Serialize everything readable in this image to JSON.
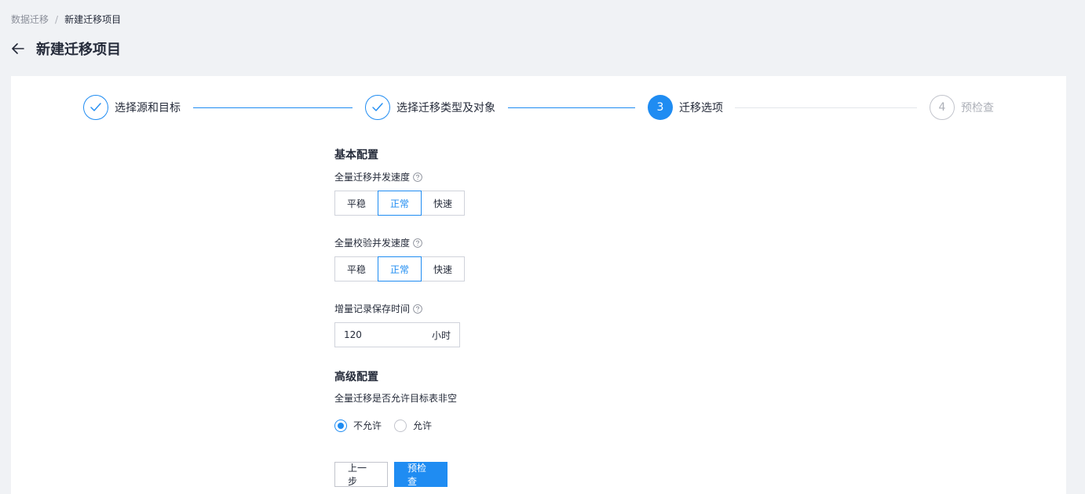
{
  "breadcrumb": {
    "parent": "数据迁移",
    "separator": "/",
    "current": "新建迁移项目"
  },
  "header": {
    "title": "新建迁移项目",
    "back_icon": "arrow-left-icon"
  },
  "steps": [
    {
      "number": "1",
      "label": "选择源和目标",
      "status": "done"
    },
    {
      "number": "2",
      "label": "选择迁移类型及对象",
      "status": "done"
    },
    {
      "number": "3",
      "label": "迁移选项",
      "status": "active"
    },
    {
      "number": "4",
      "label": "预检查",
      "status": "pending"
    }
  ],
  "basic": {
    "title": "基本配置",
    "full_migration_speed": {
      "label": "全量迁移并发速度",
      "options": [
        "平稳",
        "正常",
        "快速"
      ],
      "selected": "正常"
    },
    "full_verify_speed": {
      "label": "全量校验并发速度",
      "options": [
        "平稳",
        "正常",
        "快速"
      ],
      "selected": "正常"
    },
    "incremental_retention": {
      "label": "增量记录保存时间",
      "value": "120",
      "unit": "小时"
    }
  },
  "advanced": {
    "title": "高级配置",
    "target_nonempty": {
      "label": "全量迁移是否允许目标表非空",
      "options": [
        "不允许",
        "允许"
      ],
      "selected": "不允许"
    }
  },
  "actions": {
    "prev_label": "上一步",
    "next_label": "预检查"
  },
  "colors": {
    "accent": "#1f8cf2",
    "background": "#f0f2f5",
    "text": "#252b3a",
    "muted": "#adb0b8"
  }
}
